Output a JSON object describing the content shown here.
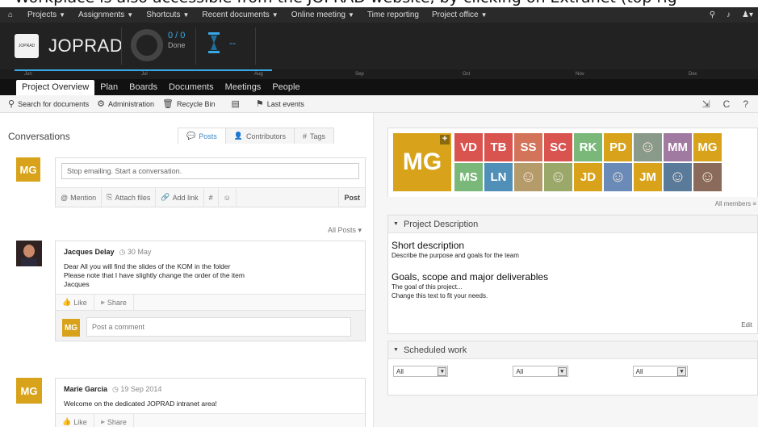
{
  "caption": "Workplace is also accessible from the JOPRAD website, by clicking on Extranet (top rig",
  "topbar": {
    "menu": [
      "Projects",
      "Assignments",
      "Shortcuts",
      "Recent documents",
      "Online meeting",
      "Time reporting",
      "Project office"
    ],
    "menu_dropdowns": [
      true,
      true,
      true,
      true,
      true,
      false,
      true
    ]
  },
  "header": {
    "logo_text": "JOPRAD",
    "project_name": "JOPRAD",
    "count": "0 / 0",
    "count_label": "Done",
    "time_value": "--"
  },
  "timeline": {
    "months": [
      "Jun",
      "Jul",
      "Aug",
      "Sep",
      "Oct",
      "Nov",
      "Dec"
    ],
    "progress": 0.34
  },
  "tabs": [
    "Project Overview",
    "Plan",
    "Boards",
    "Documents",
    "Meetings",
    "People"
  ],
  "active_tab": 0,
  "toolbar": {
    "search": "Search for documents",
    "admin": "Administration",
    "recycle": "Recycle Bin",
    "events": "Last events"
  },
  "conversations": {
    "title": "Conversations",
    "tabs": [
      "Posts",
      "Contributors",
      "Tags"
    ],
    "composer": {
      "avatar": "MG",
      "placeholder": "Stop emailing. Start a conversation.",
      "actions": [
        "Mention",
        "Attach files",
        "Add link",
        "#",
        "☺"
      ],
      "post": "Post"
    },
    "filter": "All Posts",
    "posts": [
      {
        "author": "Jacques Delay",
        "date": "30 May",
        "lines": [
          "Dear All you will find the slides of the KOM in the folder",
          "Please note that I have slightly change the order of the item",
          "Jacques"
        ],
        "like": "Like",
        "share": "Share",
        "comment_avatar": "MG",
        "comment_placeholder": "Post a comment"
      },
      {
        "author": "Marie Garcia",
        "avatar": "MG",
        "date": "19 Sep 2014",
        "lines": [
          "Welcome on the dedicated JOPRAD intranet area!"
        ],
        "like": "Like",
        "share": "Share"
      }
    ]
  },
  "members": {
    "big": "MG",
    "row1": [
      {
        "t": "VD",
        "c": "#d9534f"
      },
      {
        "t": "TB",
        "c": "#d9534f"
      },
      {
        "t": "SS",
        "c": "#d3735a"
      },
      {
        "t": "SC",
        "c": "#d9534f"
      },
      {
        "t": "RK",
        "c": "#7ab87a"
      },
      {
        "t": "PD",
        "c": "#d8a31a"
      },
      {
        "t": "",
        "c": "#8a9a8a"
      },
      {
        "t": "MM",
        "c": "#a07aa0"
      },
      {
        "t": "MG",
        "c": "#d8a31a"
      }
    ],
    "row2": [
      {
        "t": "MS",
        "c": "#7ab87a"
      },
      {
        "t": "LN",
        "c": "#4f8fb8"
      },
      {
        "t": "",
        "c": "#b59a6a"
      },
      {
        "t": "",
        "c": "#9aa86a"
      },
      {
        "t": "JD",
        "c": "#d8a31a"
      },
      {
        "t": "",
        "c": "#6a8ab8"
      },
      {
        "t": "JM",
        "c": "#d8a31a"
      },
      {
        "t": "",
        "c": "#5a7a9a"
      },
      {
        "t": "",
        "c": "#8a6a5a"
      }
    ],
    "all": "All members"
  },
  "project_description": {
    "header": "Project Description",
    "short_title": "Short description",
    "short_text": "Describe the purpose and goals for the team",
    "goals_title": "Goals, scope and major deliverables",
    "goals_lines": [
      "The goal of this project...",
      "Change this text to fit your needs."
    ],
    "edit": "Edit"
  },
  "scheduled_work": {
    "header": "Scheduled work",
    "selects": [
      "All",
      "All",
      "All"
    ]
  }
}
